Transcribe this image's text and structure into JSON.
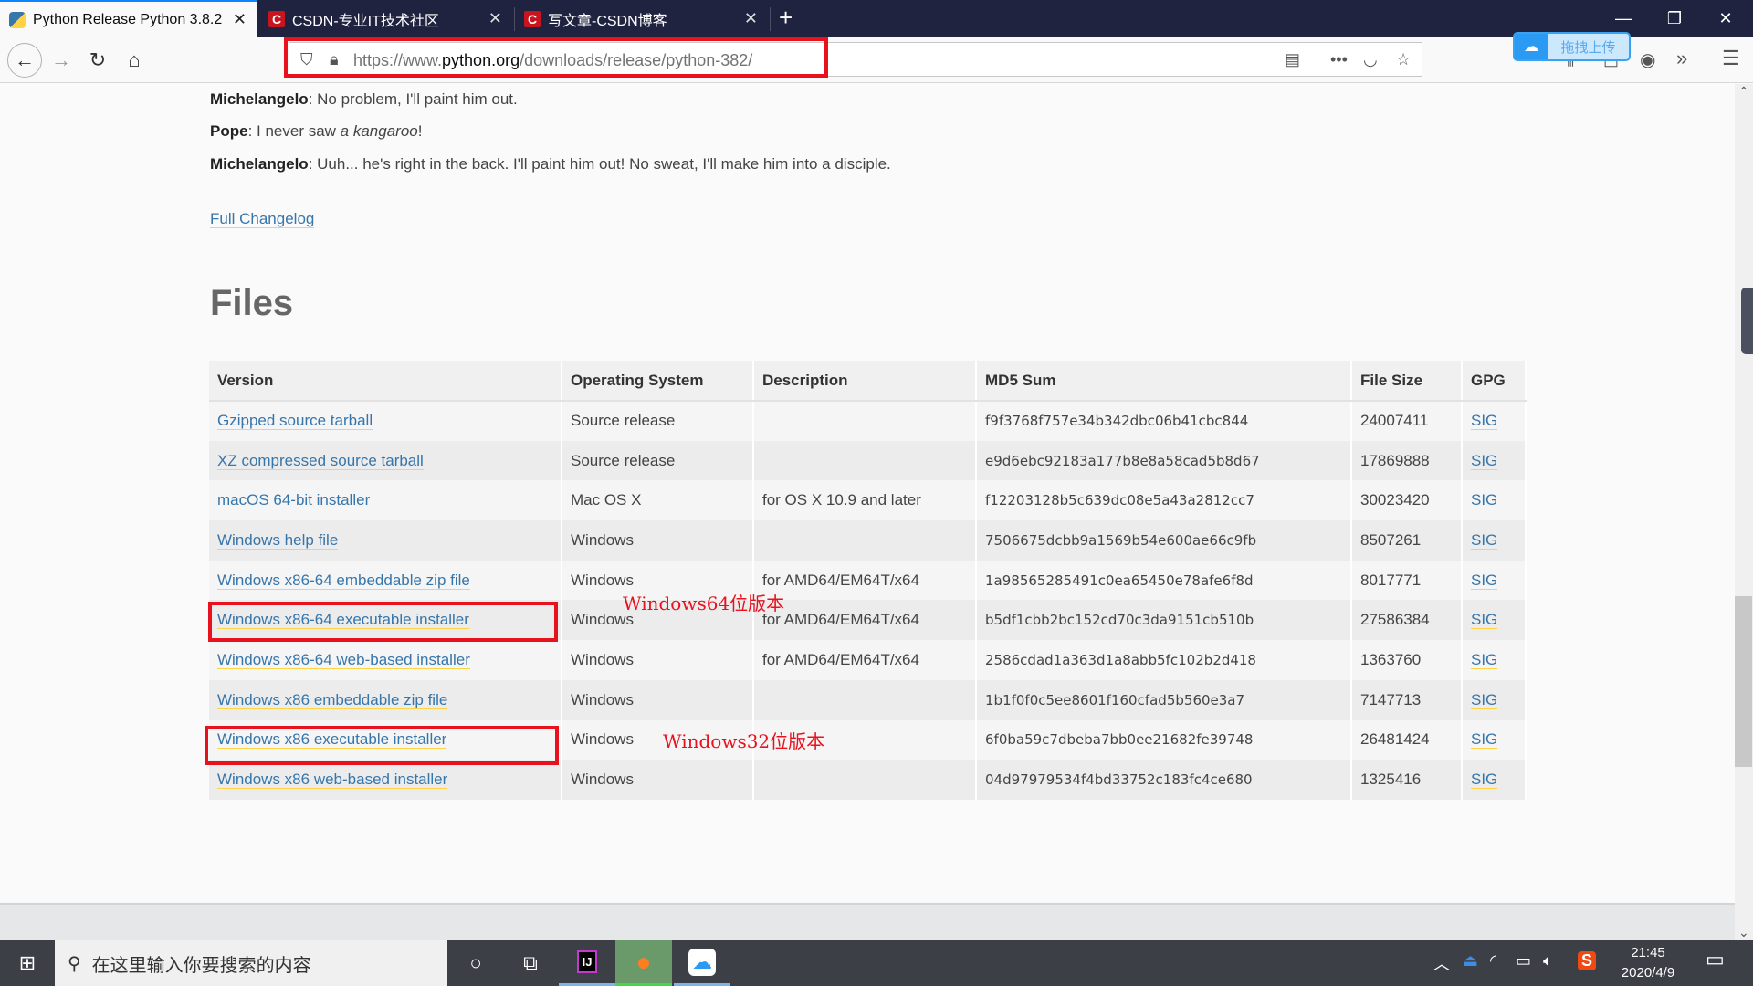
{
  "browser": {
    "tabs": [
      {
        "title": "Python Release Python 3.8.2",
        "icon": "python-icon",
        "active": true
      },
      {
        "title": "CSDN-专业IT技术社区",
        "icon": "csdn-icon",
        "active": false
      },
      {
        "title": "写文章-CSDN博客",
        "icon": "csdn-icon",
        "active": false
      }
    ],
    "new_tab": "+",
    "url_prefix": "https://www.",
    "url_domain": "python.org",
    "url_path": "/downloads/release/python-382/",
    "upload_label": "拖拽上传",
    "window": {
      "minimize": "—",
      "restore": "❐",
      "close": "✕"
    }
  },
  "page": {
    "dialogue": [
      {
        "speaker": "Michelangelo",
        "text": ": No problem, I'll paint him out."
      },
      {
        "speaker": "Pope",
        "text_before": ": I never saw ",
        "italic": "a kangaroo",
        "text_after": "!"
      },
      {
        "speaker": "Michelangelo",
        "text": ": Uuh... he's right in the back. I'll paint him out! No sweat, I'll make him into a disciple."
      }
    ],
    "changelog_link": "Full Changelog",
    "files_heading": "Files",
    "table": {
      "headers": [
        "Version",
        "Operating System",
        "Description",
        "MD5 Sum",
        "File Size",
        "GPG"
      ],
      "rows": [
        {
          "version": "Gzipped source tarball",
          "os": "Source release",
          "desc": "",
          "md5": "f9f3768f757e34b342dbc06b41cbc844",
          "size": "24007411",
          "gpg": "SIG"
        },
        {
          "version": "XZ compressed source tarball",
          "os": "Source release",
          "desc": "",
          "md5": "e9d6ebc92183a177b8e8a58cad5b8d67",
          "size": "17869888",
          "gpg": "SIG"
        },
        {
          "version": "macOS 64-bit installer",
          "os": "Mac OS X",
          "desc": "for OS X 10.9 and later",
          "md5": "f12203128b5c639dc08e5a43a2812cc7",
          "size": "30023420",
          "gpg": "SIG"
        },
        {
          "version": "Windows help file",
          "os": "Windows",
          "desc": "",
          "md5": "7506675dcbb9a1569b54e600ae66c9fb",
          "size": "8507261",
          "gpg": "SIG"
        },
        {
          "version": "Windows x86-64 embeddable zip file",
          "os": "Windows",
          "desc": "for AMD64/EM64T/x64",
          "md5": "1a98565285491c0ea65450e78afe6f8d",
          "size": "8017771",
          "gpg": "SIG"
        },
        {
          "version": "Windows x86-64 executable installer",
          "os": "Windows",
          "desc": "for AMD64/EM64T/x64",
          "md5": "b5df1cbb2bc152cd70c3da9151cb510b",
          "size": "27586384",
          "gpg": "SIG"
        },
        {
          "version": "Windows x86-64 web-based installer",
          "os": "Windows",
          "desc": "for AMD64/EM64T/x64",
          "md5": "2586cdad1a363d1a8abb5fc102b2d418",
          "size": "1363760",
          "gpg": "SIG"
        },
        {
          "version": "Windows x86 embeddable zip file",
          "os": "Windows",
          "desc": "",
          "md5": "1b1f0f0c5ee8601f160cfad5b560e3a7",
          "size": "7147713",
          "gpg": "SIG"
        },
        {
          "version": "Windows x86 executable installer",
          "os": "Windows",
          "desc": "",
          "md5": "6f0ba59c7dbeba7bb0ee21682fe39748",
          "size": "26481424",
          "gpg": "SIG"
        },
        {
          "version": "Windows x86 web-based installer",
          "os": "Windows",
          "desc": "",
          "md5": "04d97979534f4bd33752c183fc4ce680",
          "size": "1325416",
          "gpg": "SIG"
        }
      ]
    },
    "annotations": {
      "win64": "Windows64位版本",
      "win32": "Windows32位版本"
    }
  },
  "taskbar": {
    "search_placeholder": "在这里输入你要搜索的内容",
    "time": "21:45",
    "date": "2020/4/9"
  },
  "colors": {
    "link": "#3776ab",
    "link_underline": "#ffd343",
    "highlight": "#e8121f",
    "tabbar": "#202340"
  }
}
